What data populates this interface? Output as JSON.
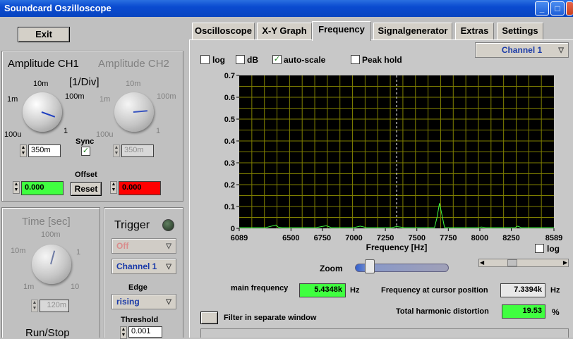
{
  "window": {
    "title": "Soundcard Oszilloscope",
    "buttons": [
      "_",
      "□",
      "X"
    ]
  },
  "left": {
    "exit_label": "Exit",
    "ch1": {
      "title": "Amplitude CH1",
      "unit": "[1/Div]",
      "ticks": {
        "t100u": "100u",
        "t1m": "1m",
        "t10m": "10m",
        "t100m": "100m",
        "t1": "1"
      },
      "value": "350m",
      "offset": "0.000"
    },
    "ch2": {
      "title": "Amplitude CH2",
      "ticks": {
        "t100u": "100u",
        "t1m": "1m",
        "t10m": "10m",
        "t100m": "100m",
        "t1": "1"
      },
      "value": "350m",
      "offset": "0.000"
    },
    "sync_label": "Sync",
    "sync_checked": true,
    "offset_label": "Offset",
    "reset_label": "Reset",
    "time": {
      "title": "Time [sec]",
      "ticks": {
        "t1m": "1m",
        "t10m": "10m",
        "t100m": "100m",
        "t1": "1",
        "t10": "10"
      },
      "value": "120m"
    },
    "trigger": {
      "title": "Trigger",
      "mode": "Off",
      "channel": "Channel 1",
      "edge_label": "Edge",
      "edge": "rising",
      "threshold_label": "Threshold",
      "threshold": "0.001"
    },
    "runstop_label": "Run/Stop"
  },
  "tabs": [
    "Oscilloscope",
    "X-Y Graph",
    "Frequency",
    "Signalgenerator",
    "Extras",
    "Settings"
  ],
  "active_tab": "Frequency",
  "options": {
    "log": "log",
    "db": "dB",
    "autoscale": "auto-scale",
    "peakhold": "Peak hold"
  },
  "channel_select": "Channel 1",
  "chart_data": {
    "type": "line",
    "xlabel": "Frequency [Hz]",
    "x_ticks": [
      "6089",
      "6500",
      "6750",
      "7000",
      "7250",
      "7500",
      "7750",
      "8000",
      "8250",
      "8589"
    ],
    "y_ticks": [
      "0",
      "0.1",
      "0.2",
      "0.3",
      "0.4",
      "0.5",
      "0.6",
      "0.7"
    ],
    "xlim": [
      6089,
      8589
    ],
    "ylim": [
      0,
      0.7
    ],
    "grid": true,
    "cursor_x": 7339.4,
    "series": [
      {
        "x": [
          6089,
          6300,
          6380,
          6400,
          6430,
          6700,
          6780,
          6820,
          7000,
          7050,
          7100,
          7300,
          7340,
          7400,
          7640,
          7660,
          7680,
          7700,
          7720,
          7760,
          8000,
          8010,
          8050,
          8280,
          8300,
          8330,
          8589
        ],
        "values": [
          0,
          0,
          0.015,
          0.005,
          0,
          0,
          0.012,
          0,
          0,
          0.01,
          0,
          0,
          0.008,
          0,
          0,
          0.05,
          0.115,
          0.06,
          0,
          0,
          0,
          0.006,
          0,
          0,
          0.01,
          0,
          0
        ]
      }
    ]
  },
  "x_log_label": "log",
  "zoom_label": "Zoom",
  "main_frequency": {
    "label": "main frequency",
    "value": "5.4348k",
    "unit": "Hz"
  },
  "cursor_frequency": {
    "label": "Frequency at cursor position",
    "value": "7.3394k",
    "unit": "Hz"
  },
  "thd": {
    "label": "Total harmonic distortion",
    "value": "19.53",
    "unit": "%"
  },
  "filter_label": "Filter in separate window",
  "colors": {
    "plot_bg": "#000000",
    "grid": "#808000",
    "trace": "#40ff40",
    "green_field": "#40ff40",
    "red_field": "#ff0000"
  }
}
